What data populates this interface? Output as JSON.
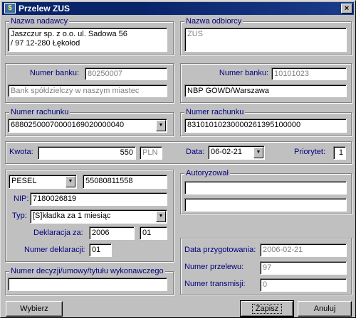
{
  "window": {
    "title": "Przelew ZUS",
    "close_glyph": "×"
  },
  "sender": {
    "legend": "Nazwa nadawcy",
    "line1": "Jaszczur sp. z o.o.  ul. Sadowa  56",
    "line2": "/ 97 12-280 Łękołod"
  },
  "recipient": {
    "legend": "Nazwa odbiorcy",
    "name": "ZUS"
  },
  "sender_bank": {
    "label": "Numer banku:",
    "number": "80250007",
    "name": "Bank spółdzielczy  w naszym miastec"
  },
  "recipient_bank": {
    "label": "Numer banku:",
    "number": "10101023",
    "name": "NBP GOWD/Warszawa"
  },
  "sender_account": {
    "legend": "Numer rachunku",
    "value": "68802500070000169020000040"
  },
  "recipient_account": {
    "legend": "Numer rachunku",
    "value": "83101010230000261395100000"
  },
  "amount": {
    "label": "Kwota:",
    "value": "550",
    "currency": "PLN"
  },
  "date": {
    "label": "Data:",
    "value": "06-02-21"
  },
  "priority": {
    "label": "Priorytet:",
    "value": "1"
  },
  "payer": {
    "id_type": "PESEL",
    "id_value": "55080811558",
    "nip_label": "NIP:",
    "nip_value": "7180026819",
    "type_label": "Typ:",
    "type_value": "[S]kładka za 1 miesiąc",
    "declaration_label": "Deklaracja za:",
    "declaration_year": "2006",
    "declaration_month": "01",
    "declaration_number_label": "Numer deklaracji:",
    "declaration_number": "01"
  },
  "authorization": {
    "legend": "Autoryzował",
    "line1": "",
    "line2": ""
  },
  "decision": {
    "legend": "Numer decyzji/umowy/tytułu wykonawczego",
    "value": ""
  },
  "info": {
    "prep_date_label": "Data przygotowania:",
    "prep_date": "2006-02-21",
    "transfer_number_label": "Numer przelewu:",
    "transfer_number": "97",
    "transmission_number_label": "Numer transmisji:",
    "transmission_number": "0"
  },
  "buttons": {
    "choose": "Wybierz",
    "save": "Zapisz",
    "cancel": "Anuluj"
  },
  "icons": {
    "combo_arrow": "▼",
    "title_icon": "$"
  }
}
